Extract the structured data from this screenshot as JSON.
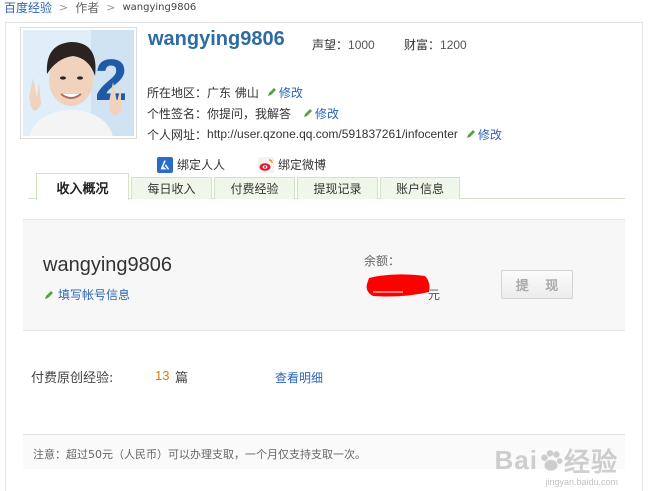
{
  "breadcrumb": {
    "home": "百度经验",
    "author": "作者",
    "user": "wangying9806"
  },
  "profile": {
    "username": "wangying9806",
    "reputation_label": "声望：",
    "reputation_value": "1000",
    "wealth_label": "财富：",
    "wealth_value": "1200",
    "region_label": "所在地区：",
    "region_value": "广东 佛山",
    "signature_label": "个性签名：",
    "signature_value": "你提问，我解答",
    "homepage_label": "个人网址：",
    "homepage_value": "http://user.qzone.qq.com/591837261/infocenter",
    "edit_label": "修改",
    "bind_renren": "绑定人人",
    "bind_weibo": "绑定微博"
  },
  "tabs": [
    "收入概况",
    "每日收入",
    "付费经验",
    "提现记录",
    "账户信息"
  ],
  "summary": {
    "name": "wangying9806",
    "fill_info": "填写帐号信息",
    "balance_label": "余额：",
    "currency": "元",
    "withdraw_button": "提 现"
  },
  "paid": {
    "label": "付费原创经验:",
    "count": "13",
    "unit": "篇",
    "view_detail": "查看明细"
  },
  "note": "注意：超过50元（人民币）可以办理支取，一个月仅支持支取一次。",
  "watermark": {
    "logo": "Bai",
    "logo_cn": "经验",
    "url": "jingyan.baidu.com"
  },
  "colors": {
    "link": "#2d64b3",
    "username": "#2d6ba5",
    "tab_bg": "#eef7ea",
    "tab_border": "#cfe4c5",
    "count": "#e07b00"
  }
}
